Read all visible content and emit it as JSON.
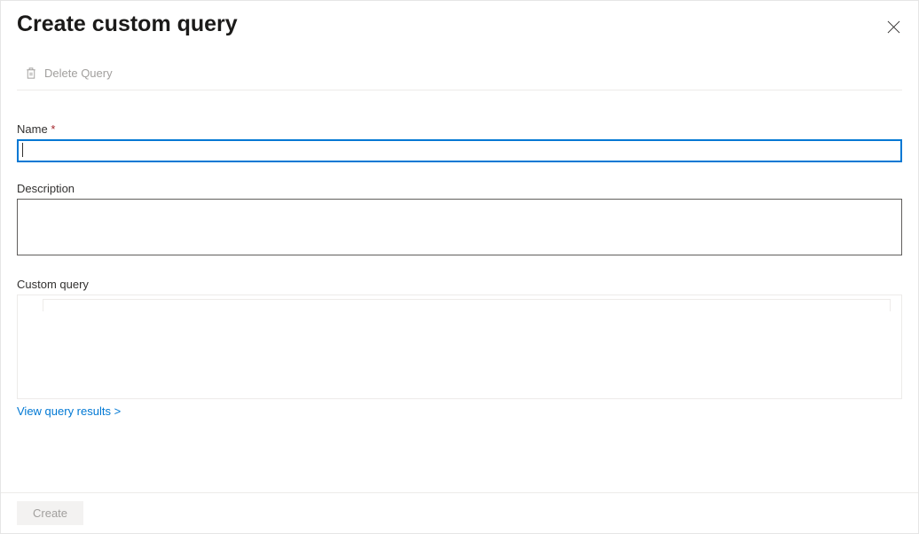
{
  "header": {
    "title": "Create custom query"
  },
  "toolbar": {
    "delete_label": "Delete Query"
  },
  "fields": {
    "name": {
      "label": "Name",
      "required": "*",
      "value": ""
    },
    "description": {
      "label": "Description",
      "value": ""
    },
    "custom_query": {
      "label": "Custom query"
    }
  },
  "link": {
    "view_results": "View query results >"
  },
  "footer": {
    "create_label": "Create"
  }
}
